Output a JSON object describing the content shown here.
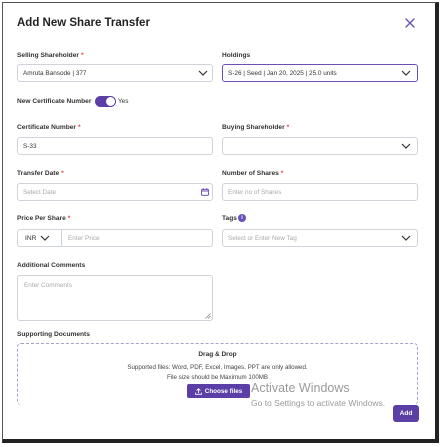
{
  "modal": {
    "title": "Add New Share Transfer",
    "close_icon": "close-icon"
  },
  "selling_shareholder": {
    "label": "Selling Shareholder",
    "value": "Amruta Bansode | 377"
  },
  "holdings": {
    "label": "Holdings",
    "value": "S-26 | Seed | Jan 20, 2025 | 25.0 units"
  },
  "new_certificate": {
    "label": "New Certificate Number",
    "toggle_text": "Yes",
    "enabled": true
  },
  "certificate_number": {
    "label": "Certificate Number",
    "value": "S-33"
  },
  "buying_shareholder": {
    "label": "Buying Shareholder",
    "value": ""
  },
  "transfer_date": {
    "label": "Transfer Date",
    "placeholder": "Select Date"
  },
  "number_of_shares": {
    "label": "Number of Shares",
    "placeholder": "Enter no of Shares"
  },
  "price_per_share": {
    "label": "Price Per Share",
    "currency": "INR",
    "placeholder": "Enter Price"
  },
  "tags": {
    "label": "Tags",
    "placeholder": "Select or Enter New Tag",
    "info": "i"
  },
  "additional_comments": {
    "label": "Additional Comments",
    "placeholder": "Enter Comments"
  },
  "supporting_documents": {
    "label": "Supporting Documents",
    "drop_title": "Drag & Drop",
    "supported_text": "Supported files: Word, PDF, Excel, Images, PPT are only allowed.",
    "size_text": "File size should be Maximum 100MB",
    "choose_label": "Choose files"
  },
  "watermark": {
    "line1": "Activate Windows",
    "line2": "Go to Settings to activate Windows."
  },
  "footer": {
    "add_label": "Add"
  },
  "colors": {
    "accent": "#5b3ea6",
    "required": "#e04545",
    "border": "#cfd3da"
  }
}
